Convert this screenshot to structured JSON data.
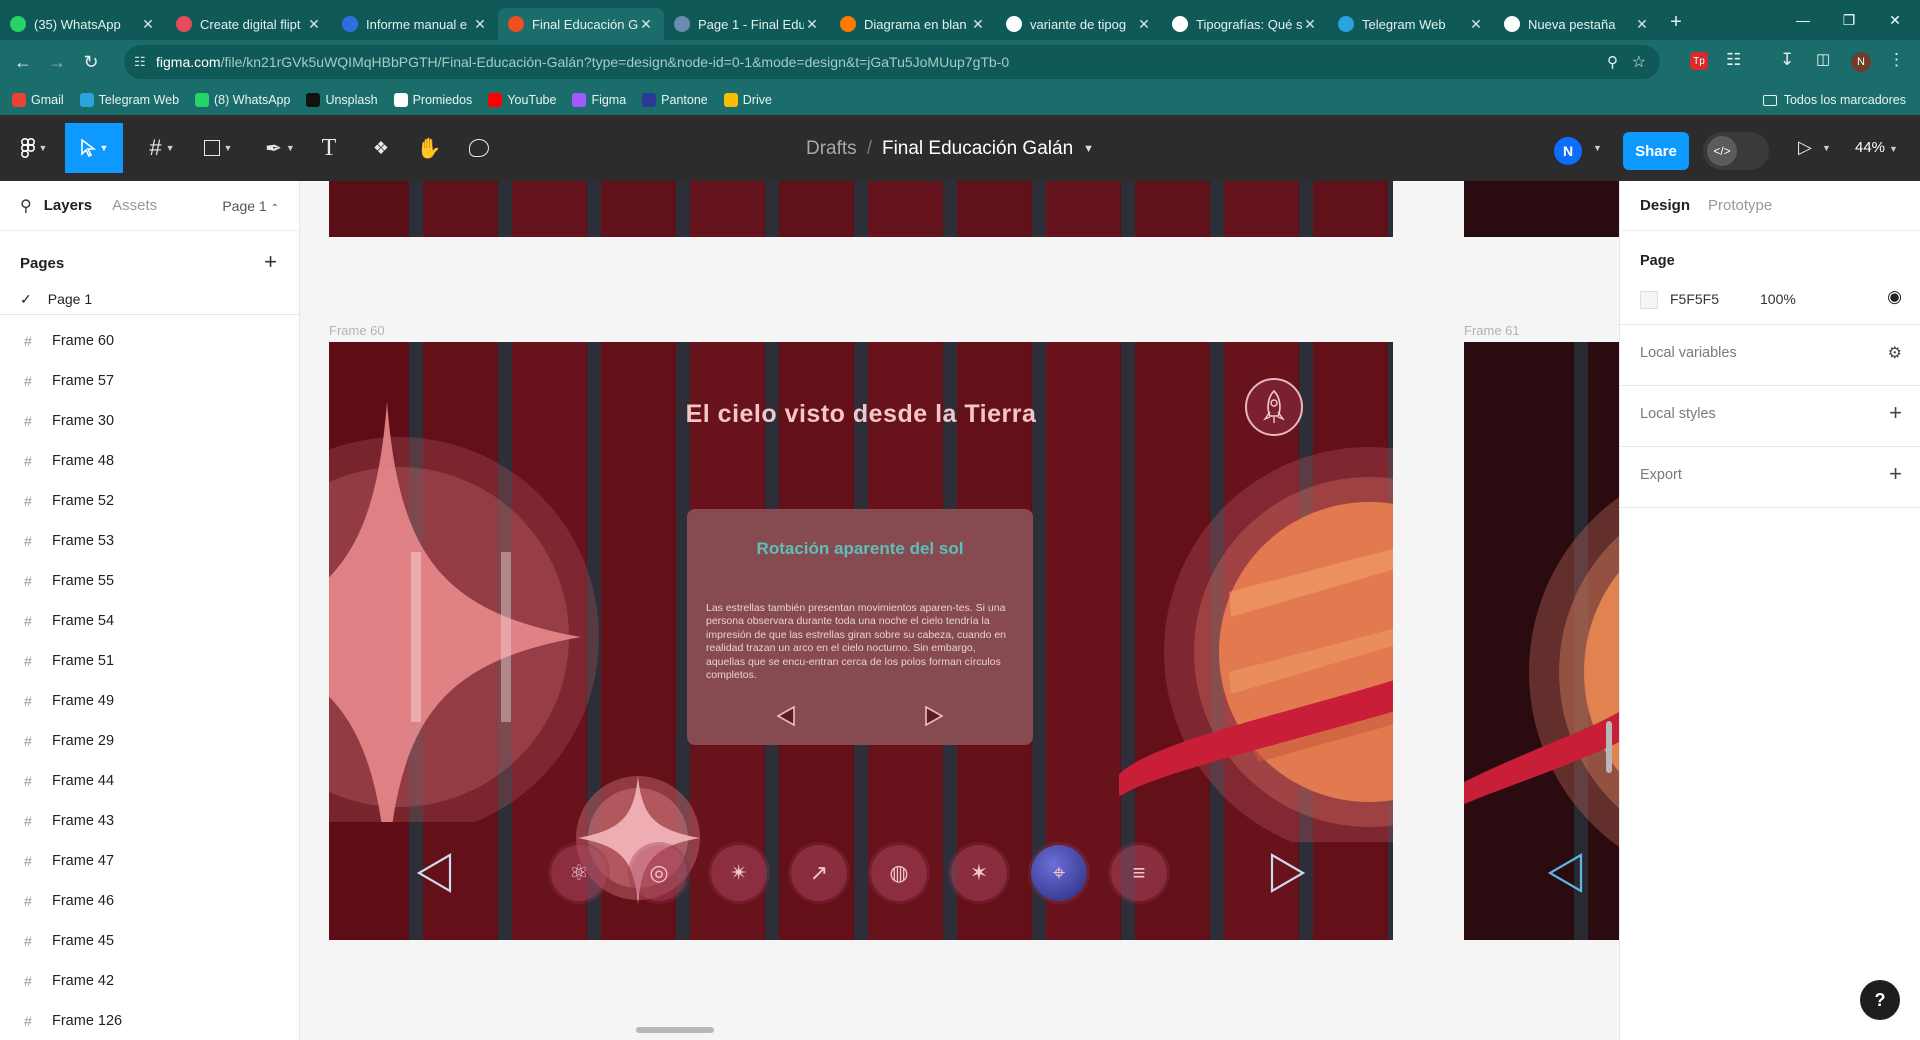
{
  "browser": {
    "tabs": [
      {
        "label": "(35) WhatsApp",
        "icon": "whatsapp-icon",
        "color": "#25d366"
      },
      {
        "label": "Create digital flipt",
        "icon": "flipbook-icon",
        "color": "#e94b5a"
      },
      {
        "label": "Informe manual e",
        "icon": "docs-icon",
        "color": "#2f6fdd"
      },
      {
        "label": "Final Educación G",
        "icon": "figma-icon",
        "color": "#f24e1e"
      },
      {
        "label": "Page 1 - Final Edu",
        "icon": "page-icon",
        "color": "#6a8caf"
      },
      {
        "label": "Diagrama en blan",
        "icon": "diagram-icon",
        "color": "#ff7a00"
      },
      {
        "label": "variante de tipog",
        "icon": "google-icon",
        "color": "#ffffff"
      },
      {
        "label": "Tipografías: Qué s",
        "icon": "notion-icon",
        "color": "#ffffff"
      },
      {
        "label": "Telegram Web",
        "icon": "telegram-icon",
        "color": "#2aa3df"
      },
      {
        "label": "Nueva pestaña",
        "icon": "chrome-icon",
        "color": "#ffffff"
      }
    ],
    "active_tab": 3,
    "url_domain": "figma.com",
    "url_rest": "/file/kn21rGVk5uWQIMqHBbPGTH/Final-Educación-Galán?type=design&node-id=0-1&mode=design&t=jGaTu5JoMUup7gTb-0",
    "profile_initial": "N",
    "bookmarks": [
      {
        "label": "Gmail",
        "color": "#ea4335"
      },
      {
        "label": "Telegram Web",
        "color": "#2aa3df"
      },
      {
        "label": "(8) WhatsApp",
        "color": "#25d366"
      },
      {
        "label": "Unsplash",
        "color": "#111111"
      },
      {
        "label": "Promiedos",
        "color": "#ffffff"
      },
      {
        "label": "YouTube",
        "color": "#ff0000"
      },
      {
        "label": "Figma",
        "color": "#a259ff"
      },
      {
        "label": "Pantone",
        "color": "#2b3a99"
      },
      {
        "label": "Drive",
        "color": "#fbbc04"
      }
    ],
    "all_bookmarks": "Todos los marcadores"
  },
  "figma": {
    "breadcrumb_drafts": "Drafts",
    "breadcrumb_sep": "/",
    "file_name": "Final Educación Galán",
    "user_initial": "N",
    "share_label": "Share",
    "zoom": "44%",
    "left_panel": {
      "tab_layers": "Layers",
      "tab_assets": "Assets",
      "page_selector": "Page 1",
      "pages_title": "Pages",
      "current_page": "Page 1",
      "layers": [
        "Frame 60",
        "Frame 57",
        "Frame 30",
        "Frame 48",
        "Frame 52",
        "Frame 53",
        "Frame 55",
        "Frame 54",
        "Frame 51",
        "Frame 49",
        "Frame 29",
        "Frame 44",
        "Frame 43",
        "Frame 47",
        "Frame 46",
        "Frame 45",
        "Frame 42",
        "Frame 126"
      ]
    },
    "right_panel": {
      "tab_design": "Design",
      "tab_prototype": "Prototype",
      "page_title": "Page",
      "page_color": "F5F5F5",
      "page_opacity": "100%",
      "local_variables": "Local variables",
      "local_styles": "Local styles",
      "export": "Export"
    },
    "canvas": {
      "frame_60_label": "Frame 60",
      "frame_61_label": "Frame 61",
      "slide_title": "El cielo visto desde la Tierra",
      "card_title": "Rotación aparente del sol",
      "card_body": "Las estrellas también presentan movimientos aparen-tes. Si una persona observara durante toda una noche el cielo tendría la impresión de que las estrellas giran sobre su cabeza, cuando en realidad trazan un arco en el cielo nocturno. Sin embargo, aquellas que se encu-entran cerca de los polos forman círculos completos.",
      "nav_icons": [
        "atom-icon",
        "planet-icon",
        "constellation-icon",
        "rocket-icon",
        "earth-icon",
        "satellite-icon",
        "telescope-icon",
        "document-icon"
      ],
      "active_nav_icon": 6,
      "colors": {
        "slide_bg": "#5e0d16",
        "stripe_dark": "#1d3a44",
        "title": "#f4c6c4",
        "card_title": "#5fc8c0",
        "card_bg": "#8a4e54",
        "star": "#e8888c",
        "planet": "#e37a4f",
        "ring": "#c81e38"
      }
    }
  }
}
